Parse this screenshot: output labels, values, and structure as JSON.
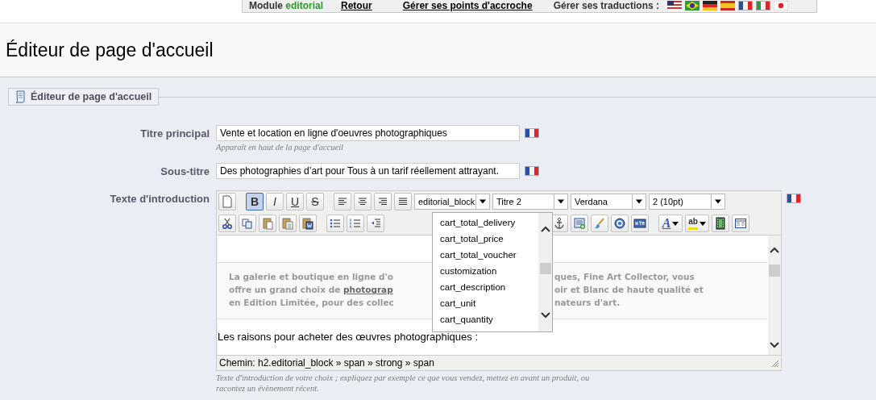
{
  "top_bar": {
    "module_label": "Module",
    "module_name": "editorial",
    "links": [
      "Retour",
      "Gérer ses points d'accroche"
    ],
    "translations_label": "Gérer ses traductions :"
  },
  "page_title": "Éditeur de page d'accueil",
  "panel": {
    "legend": "Éditeur de page d'accueil",
    "fields": [
      {
        "kind": "text",
        "label": "Titre principal",
        "value": "Vente et location en ligne d'oeuvres photographiques",
        "hint": "Apparaît en haut de la page d'accueil"
      },
      {
        "kind": "text",
        "label": "Sous-titre",
        "value": "Des photographies d’art pour Tous à un tarif réellement attrayant."
      },
      {
        "kind": "editor",
        "label": "Texte d'introduction",
        "hint": "Texte d'introduction de votre choix ; expliquez par exemple ce que vous vendez, mettez en avant un produit, ou racontez un évènement récent."
      }
    ]
  },
  "editor": {
    "format_buttons": [
      {
        "kind": "bold",
        "label": "B",
        "selected": true
      },
      {
        "kind": "italic",
        "label": "I",
        "selected": false
      },
      {
        "kind": "underline",
        "label": "U",
        "selected": false
      },
      {
        "kind": "strike",
        "label": "S",
        "selected": false
      }
    ],
    "dropdowns": [
      "editorial_block",
      "Titre 2",
      "Verdana",
      "2 (10pt)"
    ],
    "text_color_label": "A",
    "highlight_label": "ab",
    "open_menu": {
      "items": [
        {
          "label": "cart_total_delivery",
          "selected": false
        },
        {
          "label": "cart_total_price",
          "selected": false
        },
        {
          "label": "cart_total_voucher",
          "selected": false
        },
        {
          "label": "customization",
          "selected": false
        },
        {
          "label": "cart_description",
          "selected": false
        },
        {
          "label": "cart_unit",
          "selected": false
        },
        {
          "label": "cart_quantity",
          "selected": false
        }
      ]
    },
    "content": {
      "block_lines": [
        {
          "left": "La galerie et boutique en ligne d'o",
          "right": "ques, Fine Art Collector, vous"
        },
        {
          "left": "offre un grand choix de ",
          "link": "photograp",
          "right": "oir et Blanc de haute qualité et"
        },
        {
          "left": "en Edition Limitée, pour des collec",
          "right": "nateurs d'art."
        }
      ],
      "paragraph": "Les raisons pour acheter des œuvres photographiques :"
    },
    "path": "Chemin: h2.editorial_block » span » strong » span"
  }
}
